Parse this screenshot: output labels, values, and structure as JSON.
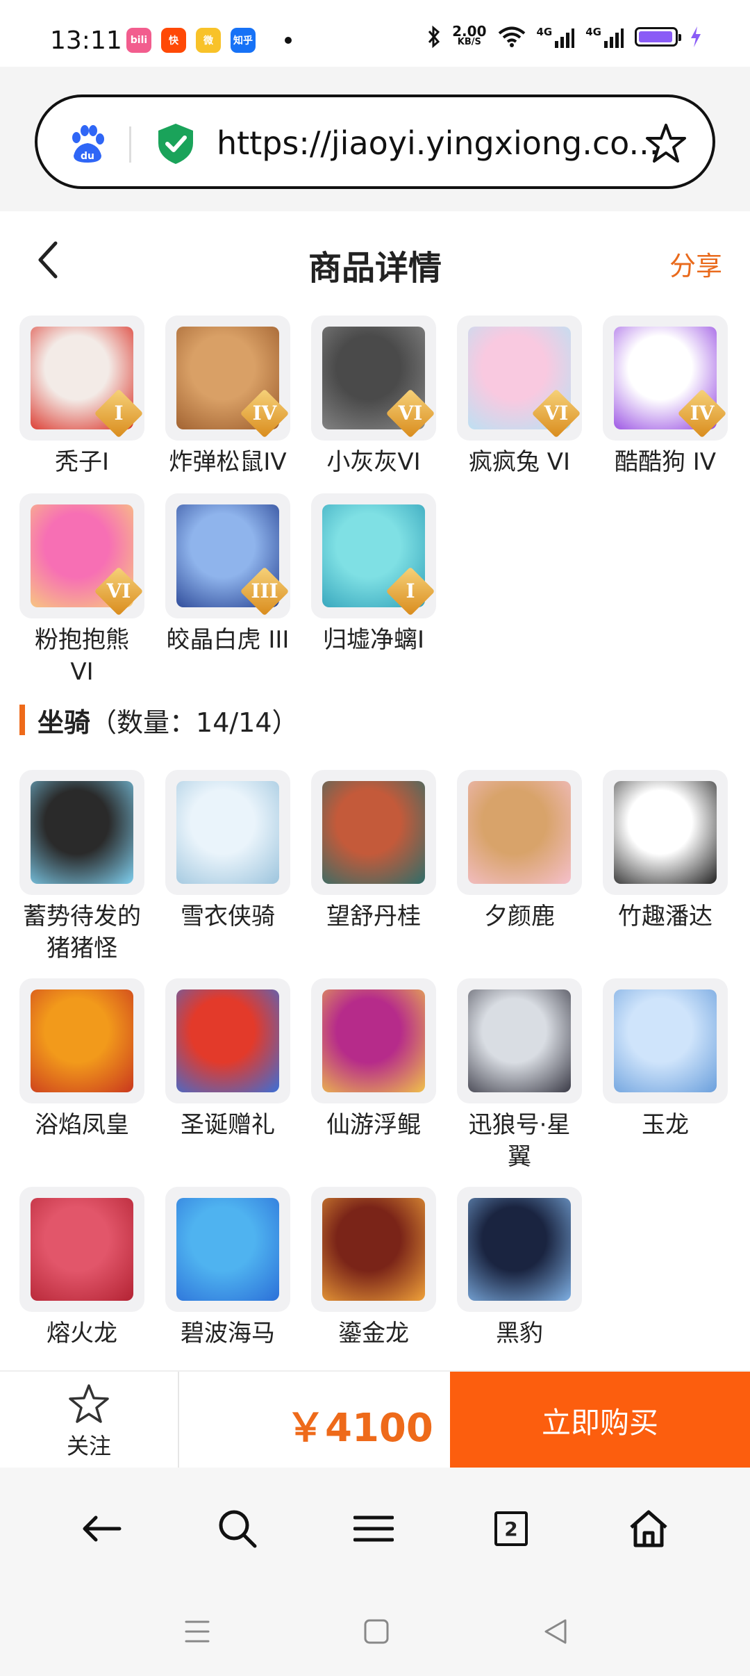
{
  "status_bar": {
    "time": "13:11",
    "apps": [
      {
        "icon": "bilibili-icon",
        "color": "#f25d8e",
        "text": "bili"
      },
      {
        "icon": "kuaishou-icon",
        "color": "#ff4906",
        "text": "快"
      },
      {
        "icon": "weibo-icon",
        "color": "#f8c229",
        "text": "微"
      },
      {
        "icon": "zhihu-icon",
        "color": "#1772f6",
        "text": "知乎"
      }
    ],
    "net_speed_value": "2.00",
    "net_speed_unit": "KB/S",
    "net_type_1": "4G",
    "net_type_2": "4G",
    "battery_level": 0.95,
    "battery_color": "#8a5cf6"
  },
  "browser": {
    "url": "https://jiaoyi.yingxiong.co...",
    "search_engine_icon": "baidu-icon",
    "secure_icon": "shield-check-icon"
  },
  "header": {
    "title": "商品详情",
    "share_label": "分享",
    "accent": "#e96a1c"
  },
  "skins": [
    {
      "name": "秃子I",
      "grade": "I",
      "colors": [
        "#f3ebe7",
        "#d9271c"
      ]
    },
    {
      "name": "炸弹松鼠IV",
      "grade": "IV",
      "colors": [
        "#d9a066",
        "#9a5a2a"
      ]
    },
    {
      "name": "小灰灰VI",
      "grade": "VI",
      "colors": [
        "#4a4a4a",
        "#8a8a8a"
      ]
    },
    {
      "name": "疯疯兔 VI",
      "grade": "VI",
      "colors": [
        "#f9c9e0",
        "#b4e3f5"
      ]
    },
    {
      "name": "酷酷狗 IV",
      "grade": "IV",
      "colors": [
        "#ffffff",
        "#8f3fe0"
      ]
    },
    {
      "name": "粉抱抱熊 VI",
      "grade": "VI",
      "colors": [
        "#f76fb4",
        "#f7d27a"
      ]
    },
    {
      "name": "皎晶白虎 III",
      "grade": "III",
      "colors": [
        "#8fb4ec",
        "#233e8f"
      ]
    },
    {
      "name": "归墟净螭I",
      "grade": "I",
      "colors": [
        "#7fe0e4",
        "#2f9fb8"
      ]
    }
  ],
  "mounts_section": {
    "title": "坐骑",
    "count_label": "（数量：14/14）"
  },
  "mounts": [
    {
      "name": "蓄势待发的猪猪怪",
      "colors": [
        "#2a2a2a",
        "#7fd0f0"
      ]
    },
    {
      "name": "雪衣侠骑",
      "colors": [
        "#eaf4fb",
        "#9cc4dd"
      ]
    },
    {
      "name": "望舒丹桂",
      "colors": [
        "#c45a3a",
        "#2e6e6a"
      ]
    },
    {
      "name": "夕颜鹿",
      "colors": [
        "#d8a36a",
        "#f5c0cc"
      ]
    },
    {
      "name": "竹趣潘达",
      "colors": [
        "#ffffff",
        "#222222"
      ]
    },
    {
      "name": "浴焰凤皇",
      "colors": [
        "#f29a1b",
        "#c9371e"
      ]
    },
    {
      "name": "圣诞赠礼",
      "colors": [
        "#e33a2a",
        "#3a6fd8"
      ]
    },
    {
      "name": "仙游浮鲲",
      "colors": [
        "#b62b8a",
        "#f0c24a"
      ]
    },
    {
      "name": "迅狼号·星翼",
      "colors": [
        "#d9dde3",
        "#3a3a46"
      ]
    },
    {
      "name": "玉龙",
      "colors": [
        "#cfe4fb",
        "#6a9fdc"
      ]
    },
    {
      "name": "熔火龙",
      "colors": [
        "#e2566a",
        "#b32333"
      ]
    },
    {
      "name": "碧波海马",
      "colors": [
        "#4fb3f0",
        "#2b6fd8"
      ]
    },
    {
      "name": "鎏金龙",
      "colors": [
        "#7a2418",
        "#f0a23a"
      ]
    },
    {
      "name": "黑豹",
      "colors": [
        "#1a2440",
        "#7fb0e4"
      ]
    }
  ],
  "action_bar": {
    "follow_label": "关注",
    "price": "￥4100",
    "buy_label": "立即购买",
    "buy_color": "#fc5e0e"
  },
  "browser_tools": {
    "tab_count": "2"
  }
}
